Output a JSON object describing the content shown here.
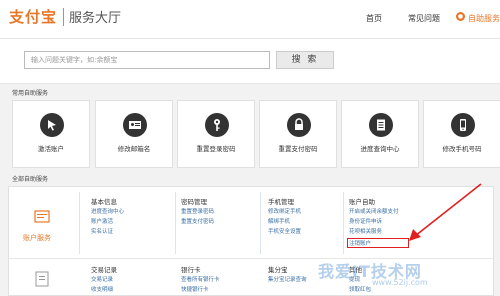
{
  "header": {
    "logo_text": "支付宝",
    "title": "服务大厅",
    "nav": [
      "首页",
      "常见问题",
      "自助服务"
    ]
  },
  "search": {
    "placeholder": "输入问题关键字，如:余额宝",
    "button_label": "搜 索"
  },
  "common_services": {
    "label": "常用自助服务",
    "items": [
      {
        "label": "激活账户",
        "icon": "cursor-icon"
      },
      {
        "label": "修改邮箱名",
        "icon": "id-card-icon"
      },
      {
        "label": "重置登录密码",
        "icon": "key-icon"
      },
      {
        "label": "重置支付密码",
        "icon": "lock-icon"
      },
      {
        "label": "进度查询中心",
        "icon": "document-icon"
      },
      {
        "label": "修改手机号码",
        "icon": "phone-icon"
      }
    ]
  },
  "all_services": {
    "label": "全部自助服务",
    "account_label": "账户服务",
    "row1": [
      {
        "title": "基本信息",
        "links": [
          "进度查询中心",
          "账户激活",
          "实名认证"
        ]
      },
      {
        "title": "密码管理",
        "links": [
          "重置登录密码",
          "重置支付密码"
        ]
      },
      {
        "title": "手机管理",
        "links": [
          "修改绑定手机",
          "解绑手机",
          "手机安全设置"
        ]
      },
      {
        "title": "账户自助",
        "links": [
          "开启或关闭余额支付",
          "身份证件申诉",
          "花呗相关服务",
          "注销账户"
        ]
      }
    ],
    "row2": [
      {
        "title": "交易记录",
        "links": [
          "交易记录",
          "收支明细"
        ]
      },
      {
        "title": "银行卡",
        "links": [
          "查看所有银行卡",
          "快捷银行卡"
        ]
      },
      {
        "title": "集分宝",
        "links": [
          "集分宝记录查询"
        ]
      },
      {
        "title": "其他",
        "links": [
          "提现",
          "领取红包"
        ]
      }
    ]
  },
  "watermark": {
    "text": "我爱IT技术网",
    "url": "www.52ij.com"
  },
  "colors": {
    "accent": "#e8772a",
    "link": "#3a6ea5",
    "highlight": "#e02020"
  }
}
